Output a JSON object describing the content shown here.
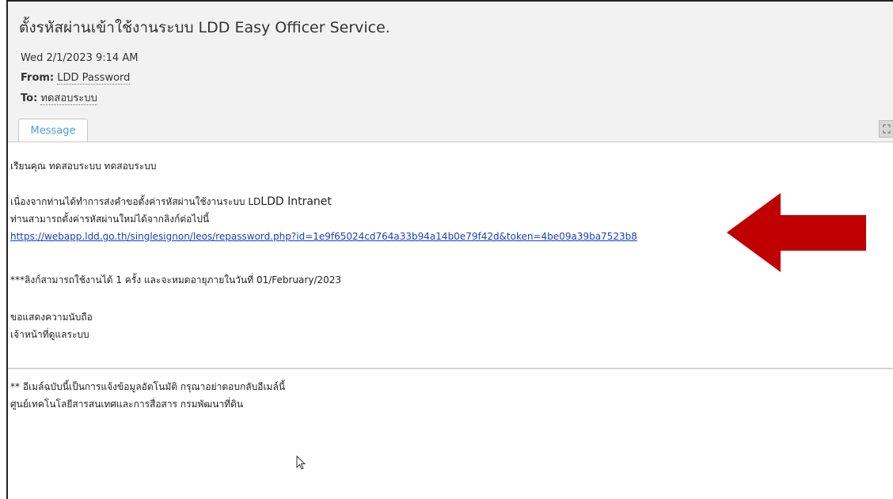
{
  "email": {
    "subject": "ตั้งรหัสผ่านเข้าใช้งานระบบ LDD Easy Officer Service.",
    "date": "Wed 2/1/2023 9:14 AM",
    "from_label": "From:",
    "from_value": "LDD Password",
    "to_label": "To:",
    "to_value": "ทดสอบระบบ"
  },
  "tabs": {
    "message": "Message"
  },
  "body": {
    "greeting": "เรียนคุณ ทดสอบระบบ ทดสอบระบบ",
    "line1_prefix": "เนื่องจากท่านได้ทำการส่งคำขอตั้งค่ารหัสผ่านใช้งานระบบ LD",
    "line1_suffix": "LDD Intranet",
    "line2": "ท่านสามารถตั้งค่ารหัสผ่านใหม่ได้จากลิงก์ต่อไปนี้",
    "link": "https://webapp.ldd.go.th/singlesignon/leos/repassword.php?id=1e9f65024cd764a33b94a14b0e79f42d&token=4be09a39ba7523b8",
    "expiry_note": "***ลิงก์สามารถใช้งานได้ 1 ครั้ง และจะหมดอายุภายในวันที่ 01/February/2023",
    "closing": "ขอแสดงความนับถือ",
    "signature": "เจ้าหน้าที่ดูแลระบบ",
    "footer_note": "** อีเมล์ฉบับนี้เป็นการแจ้งข้อมูลอัตโนมัติ กรุณาอย่าตอบกลับอีเมล์นี้",
    "footer_org": "ศูนย์เทคโนโลยีสารสนเทศและการสื่อสาร กรมพัฒนาที่ดิน"
  },
  "colors": {
    "arrow": "#c00000",
    "link": "#1a3fc4",
    "tab_text": "#4a9fd8"
  },
  "icons": {
    "expand": "expand-icon",
    "arrow": "red-arrow-annotation",
    "cursor": "mouse-pointer-icon"
  }
}
